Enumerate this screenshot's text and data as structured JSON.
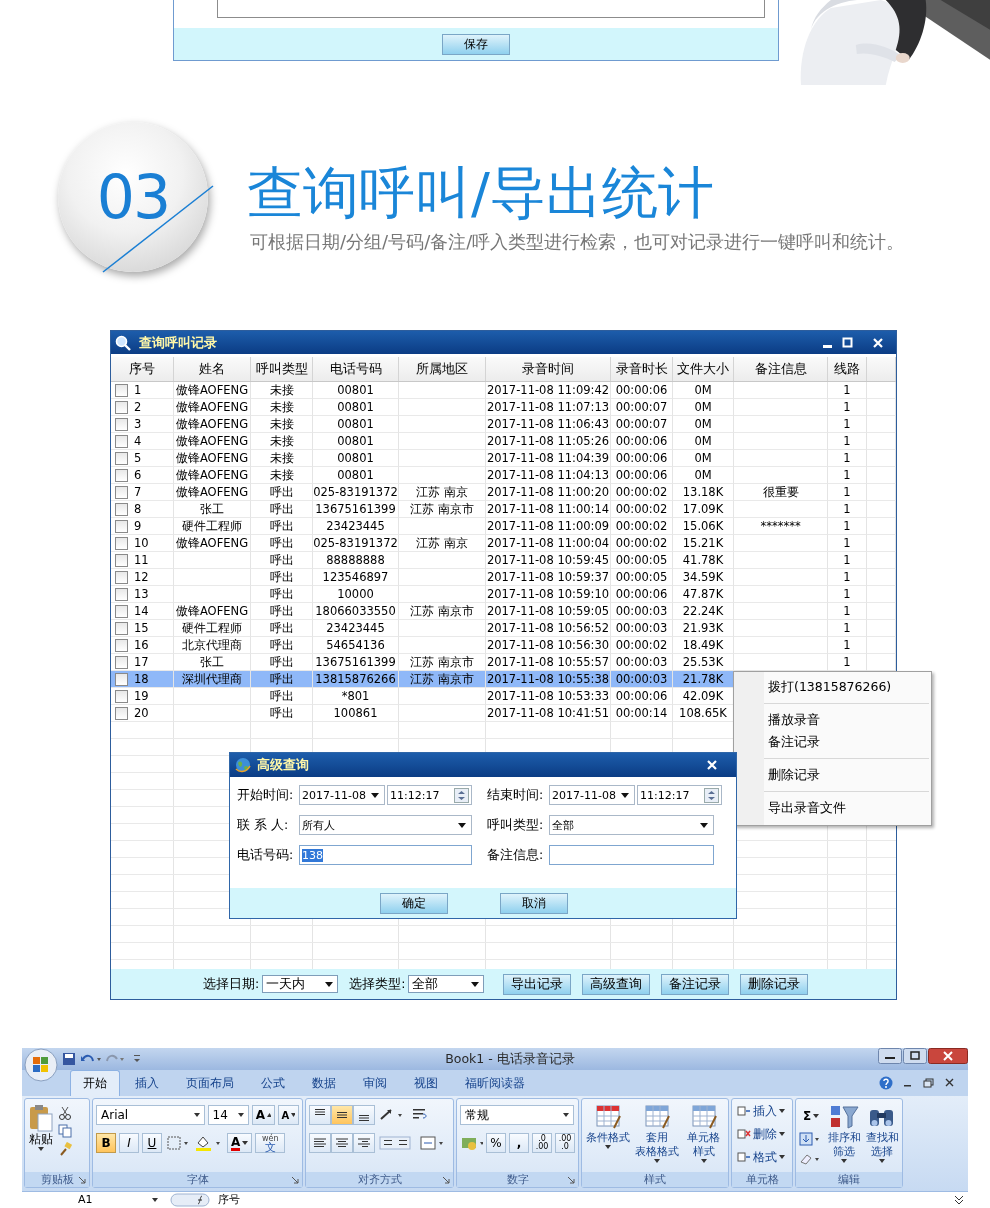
{
  "save_panel": {
    "button": "保存"
  },
  "section": {
    "number": "03",
    "title": "查询呼叫/导出统计",
    "subtitle": "可根据日期/分组/号码/备注/呼入类型进行检索，也可对记录进行一键呼叫和统计。"
  },
  "records_window": {
    "title": "查询呼叫记录",
    "columns": [
      "序号",
      "姓名",
      "呼叫类型",
      "电话号码",
      "所属地区",
      "录音时间",
      "录音时长",
      "文件大小",
      "备注信息",
      "线路"
    ],
    "rows": [
      {
        "no": "1",
        "name": "傲锋AOFENG",
        "type": "未接",
        "phone": "00801",
        "time": "2017-11-08 11:09:42",
        "duration": "00:00:06",
        "size": "0M",
        "line": "1",
        "checked": false,
        "selected": false
      },
      {
        "no": "2",
        "name": "傲锋AOFENG",
        "type": "未接",
        "phone": "00801",
        "time": "2017-11-08 11:07:13",
        "duration": "00:00:07",
        "size": "0M",
        "line": "1",
        "checked": false,
        "selected": false
      },
      {
        "no": "3",
        "name": "傲锋AOFENG",
        "type": "未接",
        "phone": "00801",
        "time": "2017-11-08 11:06:43",
        "duration": "00:00:07",
        "size": "0M",
        "line": "1",
        "checked": false,
        "selected": false
      },
      {
        "no": "4",
        "name": "傲锋AOFENG",
        "type": "未接",
        "phone": "00801",
        "time": "2017-11-08 11:05:26",
        "duration": "00:00:06",
        "size": "0M",
        "line": "1",
        "checked": false,
        "selected": false
      },
      {
        "no": "5",
        "name": "傲锋AOFENG",
        "type": "未接",
        "phone": "00801",
        "time": "2017-11-08 11:04:39",
        "duration": "00:00:06",
        "size": "0M",
        "line": "1",
        "checked": false,
        "selected": false
      },
      {
        "no": "6",
        "name": "傲锋AOFENG",
        "type": "未接",
        "phone": "00801",
        "time": "2017-11-08 11:04:13",
        "duration": "00:00:06",
        "size": "0M",
        "line": "1",
        "checked": false,
        "selected": false
      },
      {
        "no": "7",
        "name": "傲锋AOFENG",
        "type": "呼出",
        "phone": "025-83191372",
        "region": "江苏 南京",
        "time": "2017-11-08 11:00:20",
        "duration": "00:00:02",
        "size": "13.18K",
        "note": "很重要",
        "line": "1",
        "checked": false,
        "selected": false
      },
      {
        "no": "8",
        "name": "张工",
        "type": "呼出",
        "phone": "13675161399",
        "region": "江苏 南京市",
        "time": "2017-11-08 11:00:14",
        "duration": "00:00:02",
        "size": "17.09K",
        "line": "1",
        "checked": false,
        "selected": false
      },
      {
        "no": "9",
        "name": "硬件工程师",
        "type": "呼出",
        "phone": "23423445",
        "time": "2017-11-08 11:00:09",
        "duration": "00:00:02",
        "size": "15.06K",
        "note": "*******",
        "line": "1",
        "checked": false,
        "selected": false
      },
      {
        "no": "10",
        "name": "傲锋AOFENG",
        "type": "呼出",
        "phone": "025-83191372",
        "region": "江苏 南京",
        "time": "2017-11-08 11:00:04",
        "duration": "00:00:02",
        "size": "15.21K",
        "line": "1",
        "checked": false,
        "selected": false
      },
      {
        "no": "11",
        "type": "呼出",
        "phone": "88888888",
        "time": "2017-11-08 10:59:45",
        "duration": "00:00:05",
        "size": "41.78K",
        "line": "1",
        "checked": false,
        "selected": false
      },
      {
        "no": "12",
        "type": "呼出",
        "phone": "123546897",
        "time": "2017-11-08 10:59:37",
        "duration": "00:00:05",
        "size": "34.59K",
        "line": "1",
        "checked": false,
        "selected": false
      },
      {
        "no": "13",
        "type": "呼出",
        "phone": "10000",
        "time": "2017-11-08 10:59:10",
        "duration": "00:00:06",
        "size": "47.87K",
        "line": "1",
        "checked": false,
        "selected": false
      },
      {
        "no": "14",
        "name": "傲锋AOFENG",
        "type": "呼出",
        "phone": "18066033550",
        "region": "江苏 南京市",
        "time": "2017-11-08 10:59:05",
        "duration": "00:00:03",
        "size": "22.24K",
        "line": "1",
        "checked": false,
        "selected": false
      },
      {
        "no": "15",
        "name": "硬件工程师",
        "type": "呼出",
        "phone": "23423445",
        "time": "2017-11-08 10:56:52",
        "duration": "00:00:03",
        "size": "21.93K",
        "line": "1",
        "checked": false,
        "selected": false
      },
      {
        "no": "16",
        "name": "北京代理商",
        "type": "呼出",
        "phone": "54654136",
        "time": "2017-11-08 10:56:30",
        "duration": "00:00:02",
        "size": "18.49K",
        "line": "1",
        "checked": false,
        "selected": false
      },
      {
        "no": "17",
        "name": "张工",
        "type": "呼出",
        "phone": "13675161399",
        "region": "江苏 南京市",
        "time": "2017-11-08 10:55:57",
        "duration": "00:00:03",
        "size": "25.53K",
        "line": "1",
        "checked": false,
        "selected": false
      },
      {
        "no": "18",
        "name": "深圳代理商",
        "type": "呼出",
        "phone": "13815876266",
        "region": "江苏 南京市",
        "time": "2017-11-08 10:55:38",
        "duration": "00:00:03",
        "size": "21.78K",
        "checked": false,
        "selected": true
      },
      {
        "no": "19",
        "type": "呼出",
        "phone": "*801",
        "time": "2017-11-08 10:53:33",
        "duration": "00:00:06",
        "size": "42.09K",
        "checked": false,
        "selected": false
      },
      {
        "no": "20",
        "type": "呼出",
        "phone": "100861",
        "time": "2017-11-08 10:41:51",
        "duration": "00:00:14",
        "size": "108.65K",
        "checked": false,
        "selected": false
      }
    ],
    "toolbar": {
      "date_label": "选择日期:",
      "date_value": "一天内",
      "type_label": "选择类型:",
      "type_value": "全部",
      "buttons": [
        "导出记录",
        "高级查询",
        "备注记录",
        "删除记录"
      ]
    },
    "context_menu": {
      "groups": [
        [
          "拨打(13815876266)"
        ],
        [
          "播放录音",
          "备注记录"
        ],
        [
          "删除记录"
        ],
        [
          "导出录音文件"
        ]
      ]
    },
    "dialog": {
      "title": "高级查询",
      "start": {
        "label": "开始时间:",
        "date": "2017-11-08",
        "time": "11:12:17"
      },
      "end": {
        "label": "结束时间:",
        "date": "2017-11-08",
        "time": "11:12:17"
      },
      "contact": {
        "label": "联 系 人:",
        "value": "所有人"
      },
      "call_type": {
        "label": "呼叫类型:",
        "value": "全部"
      },
      "phone": {
        "label": "电话号码:",
        "value": "138",
        "text_selected": true
      },
      "note": {
        "label": "备注信息:"
      },
      "buttons": [
        "确定",
        "取消"
      ]
    }
  },
  "excel": {
    "title": "Book1 - 电话录音记录",
    "tabs": [
      {
        "label": "开始",
        "selected": true
      },
      {
        "label": "插入",
        "selected": false
      },
      {
        "label": "页面布局",
        "selected": false
      },
      {
        "label": "公式",
        "selected": false
      },
      {
        "label": "数据",
        "selected": false
      },
      {
        "label": "审阅",
        "selected": false
      },
      {
        "label": "视图",
        "selected": false
      },
      {
        "label": "福昕阅读器",
        "selected": false
      }
    ],
    "clipboard": {
      "label": "剪贴板",
      "paste": "粘贴"
    },
    "font": {
      "label": "字体",
      "name": "Arial",
      "size": "14",
      "grow": "A",
      "shrink": "A",
      "bold": {
        "text": "B",
        "on": true
      },
      "italic": {
        "text": "I",
        "on": false
      },
      "underline": {
        "text": "U",
        "on": false
      },
      "font_color_letter": "A",
      "phonetic": [
        "wén",
        "文"
      ]
    },
    "alignment": {
      "label": "对齐方式",
      "vertical": [
        {
          "kind": "top",
          "on": false
        },
        {
          "kind": "middle",
          "on": true
        },
        {
          "kind": "bottom",
          "on": false
        }
      ],
      "horizontal": [
        {
          "kind": "left"
        },
        {
          "kind": "center"
        },
        {
          "kind": "right"
        }
      ]
    },
    "number": {
      "label": "数字",
      "format": "常规",
      "percent": "%",
      "comma": ",",
      "increase_decimal": [
        ".0",
        ".00"
      ],
      "decrease_decimal": [
        ".00",
        ".0"
      ]
    },
    "styles": {
      "label": "样式",
      "buttons": [
        [
          "条件格式"
        ],
        [
          "套用",
          "表格格式"
        ],
        [
          "单元格",
          "样式"
        ]
      ]
    },
    "cells": {
      "label": "单元格",
      "buttons": [
        "插入",
        "删除",
        "格式"
      ]
    },
    "editing": {
      "label": "编辑",
      "sum": "Σ",
      "buttons": [
        [
          "排序和",
          "筛选"
        ],
        [
          "查找和",
          "选择"
        ]
      ]
    },
    "formula_bar": {
      "cell": "A1",
      "content": "序号"
    }
  }
}
